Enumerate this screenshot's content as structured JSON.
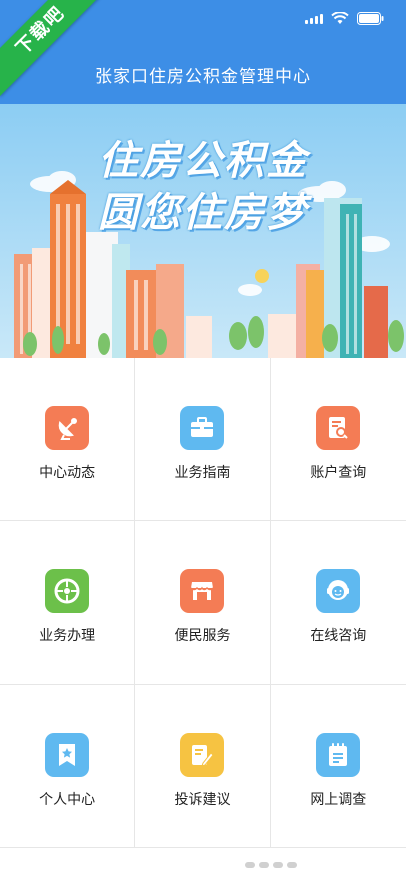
{
  "badge": {
    "text": "下载吧"
  },
  "header": {
    "title": "张家口住房公积金管理中心"
  },
  "banner": {
    "line1": "住房公积金",
    "line2": "圆您住房梦"
  },
  "menu": [
    {
      "label": "中心动态",
      "icon": "satellite-dish-icon",
      "color": "#f47c55"
    },
    {
      "label": "业务指南",
      "icon": "briefcase-icon",
      "color": "#5fb9f0"
    },
    {
      "label": "账户查询",
      "icon": "document-search-icon",
      "color": "#f47c55"
    },
    {
      "label": "业务办理",
      "icon": "target-icon",
      "color": "#6cc04a"
    },
    {
      "label": "便民服务",
      "icon": "storefront-icon",
      "color": "#f47c55"
    },
    {
      "label": "在线咨询",
      "icon": "customer-service-icon",
      "color": "#5fb9f0"
    },
    {
      "label": "个人中心",
      "icon": "bookmark-icon",
      "color": "#5fb9f0"
    },
    {
      "label": "投诉建议",
      "icon": "edit-icon",
      "color": "#f6c342"
    },
    {
      "label": "网上调查",
      "icon": "survey-notebook-icon",
      "color": "#5fb9f0"
    }
  ]
}
